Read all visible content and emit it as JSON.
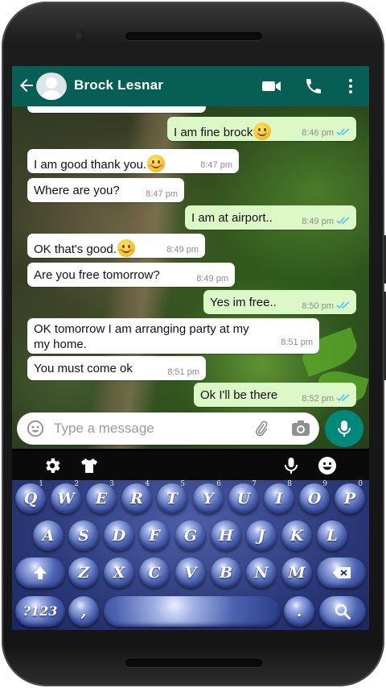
{
  "header": {
    "contact_name": "Brock Lesnar",
    "back_icon": "back-arrow-icon",
    "actions": [
      "video-call-icon",
      "phone-call-icon",
      "more-vert-icon"
    ],
    "color": "#075e54"
  },
  "messages": [
    {
      "dir": "out",
      "text": "I am fine brock",
      "emoji": "smile",
      "time": "8:46 pm",
      "status": "read"
    },
    {
      "dir": "in",
      "text": "I am good thank you.",
      "emoji": "blush",
      "time": "8:47 pm"
    },
    {
      "dir": "in",
      "text": "Where are you?",
      "time": "8:47 pm"
    },
    {
      "dir": "out",
      "text": "I am at airport..",
      "time": "8:49 pm",
      "status": "read"
    },
    {
      "dir": "in",
      "text": "OK that's good.",
      "emoji": "relaxed",
      "time": "8:49 pm"
    },
    {
      "dir": "in",
      "text": "Are you free tomorrow?",
      "time": "8:49 pm"
    },
    {
      "dir": "out",
      "text": "Yes im free..",
      "time": "8:50 pm",
      "status": "read"
    },
    {
      "dir": "in",
      "text": "OK tomorrow I am arranging party at my my home.",
      "time": "8:51 pm"
    },
    {
      "dir": "in",
      "text": "You must come ok",
      "time": "8:51 pm"
    },
    {
      "dir": "out",
      "text": "Ok I'll be there",
      "time": "8:52 pm",
      "status": "read"
    }
  ],
  "composer": {
    "placeholder": "Type a message",
    "icons": [
      "emoji-icon",
      "attach-icon",
      "camera-icon",
      "mic-icon"
    ]
  },
  "keyboard_toolbar": {
    "icons": [
      "settings-icon",
      "theme-shirt-icon",
      "voice-input-icon",
      "emoji-panel-icon"
    ]
  },
  "keyboard": {
    "row1": [
      {
        "label": "Q",
        "sup": "1"
      },
      {
        "label": "W",
        "sup": "2"
      },
      {
        "label": "E",
        "sup": "3"
      },
      {
        "label": "R",
        "sup": "4"
      },
      {
        "label": "T",
        "sup": "5"
      },
      {
        "label": "Y",
        "sup": "6"
      },
      {
        "label": "U",
        "sup": "7"
      },
      {
        "label": "I",
        "sup": "8"
      },
      {
        "label": "O",
        "sup": "9"
      },
      {
        "label": "P",
        "sup": "0"
      }
    ],
    "row2": [
      "A",
      "S",
      "D",
      "F",
      "G",
      "H",
      "J",
      "K",
      "L"
    ],
    "row3": [
      "Z",
      "X",
      "C",
      "V",
      "B",
      "N",
      "M"
    ],
    "symbols_label": "?123",
    "comma_label": ",",
    "period_label": ".",
    "special_keys": [
      "shift-icon",
      "backspace-icon",
      "search-icon"
    ]
  }
}
